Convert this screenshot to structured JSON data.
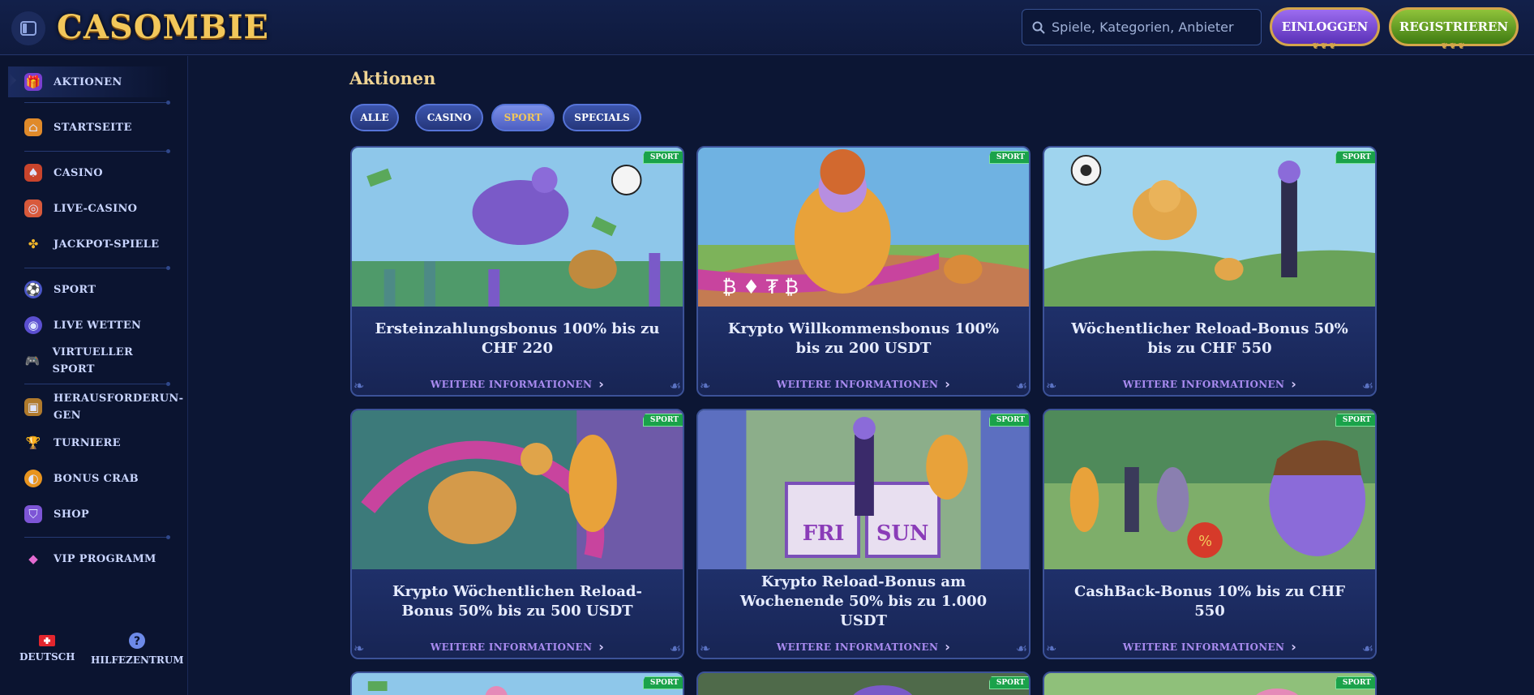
{
  "header": {
    "logo": "CASOMBIE",
    "search_placeholder": "Spiele, Kategorien, Anbieter",
    "login_label": "EINLOGGEN",
    "register_label": "REGISTRIEREN"
  },
  "sidebar": {
    "items": [
      {
        "label": "AKTIONEN",
        "icon": "gift-icon"
      },
      {
        "label": "STARTSEITE",
        "icon": "house-icon"
      },
      {
        "label": "CASINO",
        "icon": "cards-icon"
      },
      {
        "label": "LIVE-CASINO",
        "icon": "roulette-icon"
      },
      {
        "label": "JACKPOT-SPIELE",
        "icon": "clover-icon"
      },
      {
        "label": "SPORT",
        "icon": "soccer-ball-icon"
      },
      {
        "label": "LIVE WETTEN",
        "icon": "live-bets-icon"
      },
      {
        "label": "VIRTUELLER SPORT",
        "icon": "gamepad-icon"
      },
      {
        "label": "HERAUSFORDERUN-GEN",
        "icon": "chest-icon"
      },
      {
        "label": "TURNIERE",
        "icon": "trophy-icon"
      },
      {
        "label": "BONUS CRAB",
        "icon": "crab-icon"
      },
      {
        "label": "SHOP",
        "icon": "basket-icon"
      },
      {
        "label": "VIP PROGRAMM",
        "icon": "diamond-icon"
      }
    ],
    "footer": {
      "language": "DEUTSCH",
      "help": "HILFEZENTRUM"
    }
  },
  "main": {
    "title": "Aktionen",
    "filters": [
      "ALLE",
      "CASINO",
      "SPORT",
      "SPECIALS"
    ],
    "selected_filter": "SPORT",
    "more_label": "WEITERE INFORMATIONEN",
    "badge_label": "SPORT",
    "cards": [
      {
        "title": "Ersteinzahlungsbonus 100% bis zu CHF 220"
      },
      {
        "title": "Krypto Willkommensbonus 100% bis zu 200 USDT"
      },
      {
        "title": "Wöchentlicher Reload-Bonus 50% bis zu CHF 550"
      },
      {
        "title": "Krypto Wöchentlichen Reload-Bonus 50% bis zu 500 USDT"
      },
      {
        "title": "Krypto Reload-Bonus am Wochenende 50% bis zu 1.000 USDT"
      },
      {
        "title": "CashBack-Bonus 10% bis zu CHF 550"
      }
    ]
  },
  "colors": {
    "background": "#0c1634",
    "accent_gold": "#f2c75a",
    "login_purple": "#7b4fd6",
    "register_green": "#5f9e22",
    "badge_green": "#1aa24a"
  }
}
